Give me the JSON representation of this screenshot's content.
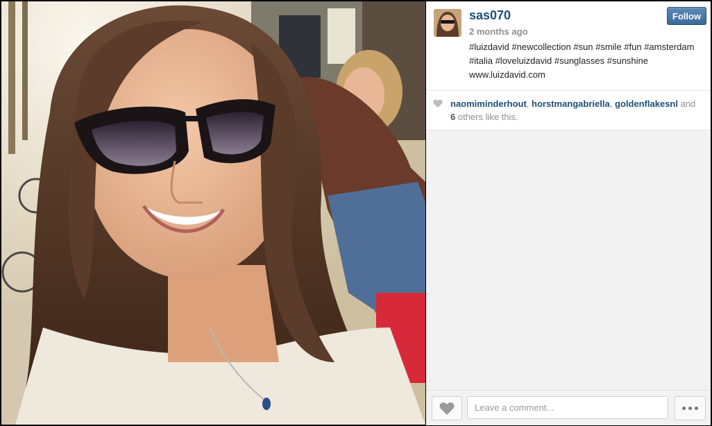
{
  "post": {
    "username": "sas070",
    "time_ago": "2 months ago",
    "follow_label": "Follow",
    "caption": "#luizdavid #newcollection #sun #smile #fun #amsterdam #italia #loveluizdavid #sunglasses #sunshine www.luizdavid.com"
  },
  "likes": {
    "user1": "naomiminderhout",
    "sep1": ", ",
    "user2": "horstmangabriella",
    "sep2": ", ",
    "user3": "goldenflakesnl",
    "and_text": " and ",
    "others_count": "6",
    "others_text": " others like this."
  },
  "comment": {
    "placeholder": "Leave a comment..."
  },
  "icons": {
    "heart": "heart-icon",
    "more": "more-options-icon"
  },
  "colors": {
    "username": "#1c4f7a",
    "follow_button": "#3b6a99"
  }
}
